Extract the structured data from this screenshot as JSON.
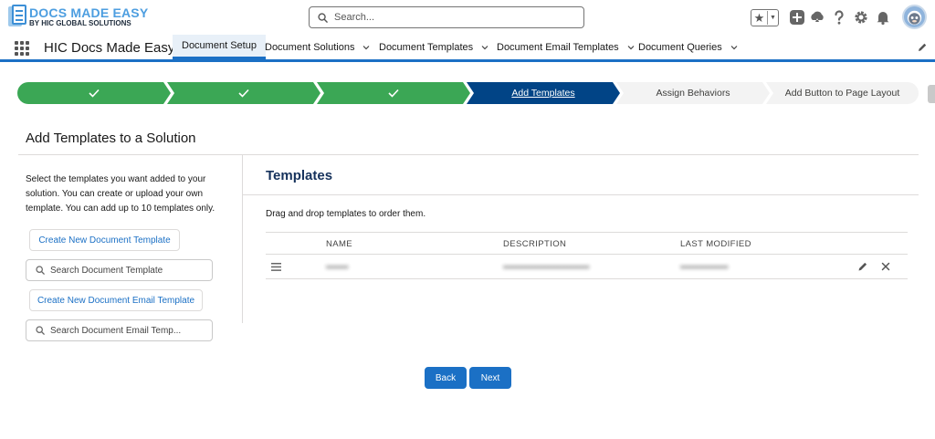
{
  "header": {
    "logo": {
      "title": "DOCS MADE EASY",
      "subtitle": "BY HIC GLOBAL SOLUTIONS"
    },
    "search": {
      "placeholder": "Search..."
    },
    "icons": [
      "favorites-star-icon",
      "add-icon",
      "trailhead-icon",
      "help-icon",
      "setup-gear-icon",
      "notifications-bell-icon",
      "avatar"
    ]
  },
  "nav": {
    "app_name": "HIC Docs Made Easy",
    "tabs": [
      {
        "label": "Document Setup",
        "active": true
      },
      {
        "label": "Document Solutions",
        "active": false
      },
      {
        "label": "Document Templates",
        "active": false
      },
      {
        "label": "Document Email Templates",
        "active": false
      },
      {
        "label": "Document Queries",
        "active": false
      }
    ]
  },
  "path": {
    "steps": [
      {
        "label": "",
        "status": "complete"
      },
      {
        "label": "",
        "status": "complete"
      },
      {
        "label": "",
        "status": "complete"
      },
      {
        "label": "Add Templates",
        "status": "current"
      },
      {
        "label": "Assign Behaviors",
        "status": "todo"
      },
      {
        "label": "Add Button to Page Layout",
        "status": "todo"
      }
    ]
  },
  "page": {
    "title": "Add Templates to a Solution"
  },
  "left": {
    "description": "Select the templates you want added to your solution. You can create or upload your own template. You can add up to 10 templates only.",
    "create_doc_label": "Create New Document Template",
    "search_doc_placeholder": "Search Document Template",
    "create_email_label": "Create New Document Email Template",
    "search_email_placeholder": "Search Document Email Temp..."
  },
  "templates": {
    "title": "Templates",
    "hint": "Drag and drop templates to order them.",
    "columns": [
      "NAME",
      "DESCRIPTION",
      "LAST MODIFIED"
    ],
    "rows": [
      {
        "name": "•••••••",
        "description": "•••••••••••••••••••••••••••",
        "last_modified": "•••••••••••••••"
      }
    ]
  },
  "footer": {
    "back_label": "Back",
    "next_label": "Next"
  },
  "colors": {
    "brand": "#1b70c5",
    "complete": "#3ba755",
    "current": "#014486",
    "todo": "#f3f3f3",
    "title_navy": "#16325c"
  }
}
